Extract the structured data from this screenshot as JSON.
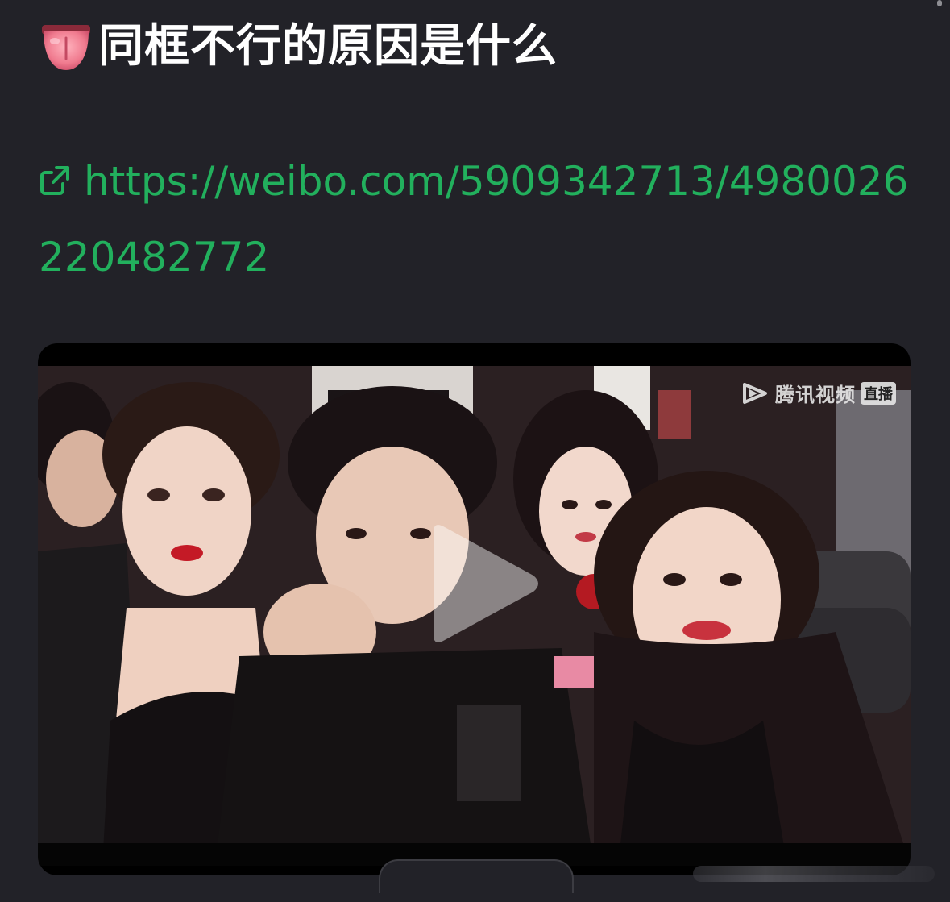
{
  "post": {
    "title": "同框不行的原因是什么",
    "title_emoji": "tongue-emoji-icon",
    "link_icon": "external-link-icon",
    "link_text": "https://weibo.com/5909342713/4980026220482772"
  },
  "video": {
    "watermark_brand": "腾讯视频",
    "watermark_badge": "直播",
    "play_icon": "play-icon",
    "thumbnail": "concert-audience-thumbnail"
  },
  "colors": {
    "background": "#222228",
    "link": "#22b05d",
    "title": "#ffffff",
    "video_bg": "#000000"
  }
}
